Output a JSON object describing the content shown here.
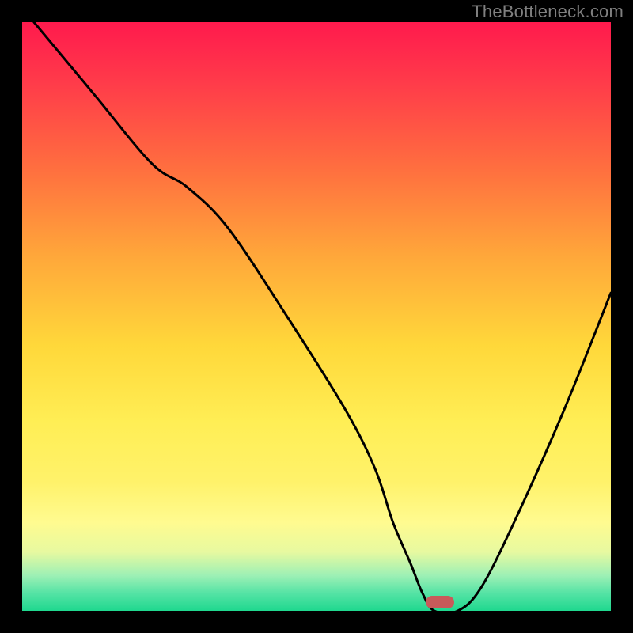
{
  "watermark": "TheBottleneck.com",
  "chart_data": {
    "type": "line",
    "title": "",
    "xlabel": "",
    "ylabel": "",
    "xlim": [
      0,
      100
    ],
    "ylim": [
      0,
      100
    ],
    "series": [
      {
        "name": "curve",
        "color": "#000000",
        "x": [
          2,
          12,
          22,
          28,
          35,
          45,
          55,
          60,
          63,
          66,
          68,
          70,
          74,
          78,
          84,
          92,
          100
        ],
        "y": [
          100,
          88,
          76,
          72,
          65,
          50,
          34,
          24,
          15,
          8,
          3,
          0,
          0,
          4,
          16,
          34,
          54
        ]
      }
    ],
    "marker": {
      "x": 71,
      "y": 1.5,
      "color": "#c85a5a"
    },
    "gradient_stops": [
      {
        "pos": 0,
        "color": "#ff1a4d"
      },
      {
        "pos": 25,
        "color": "#ff6f3f"
      },
      {
        "pos": 55,
        "color": "#ffd83a"
      },
      {
        "pos": 85,
        "color": "#fffb90"
      },
      {
        "pos": 100,
        "color": "#1fd88f"
      }
    ]
  }
}
